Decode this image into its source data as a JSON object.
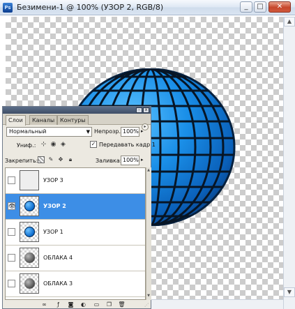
{
  "window": {
    "title": "Безимени-1 @ 100% (УЗОР 2, RGB/8)",
    "app_icon": "photoshop-icon",
    "controls": {
      "minimize": "_",
      "maximize": "□",
      "close": "✕"
    }
  },
  "canvas": {
    "background": "transparent-checkerboard",
    "object": "blue-grid-sphere",
    "sphere_color": "#1a8fe8",
    "grid_color": "#0a1a2a"
  },
  "layers_panel": {
    "tabs": [
      "Слои",
      "Каналы",
      "Контуры"
    ],
    "active_tab": "Слои",
    "blend_mode": "Нормальный",
    "opacity_label": "Непрозр.:",
    "opacity_value": "100%",
    "unify_label": "Униф.:",
    "propagate_label": "Передавать кадр 1",
    "propagate_checked": true,
    "lock_label": "Закрепить:",
    "fill_label": "Заливка:",
    "fill_value": "100%",
    "layers": [
      {
        "name": "УЗОР 3",
        "thumb": "blank",
        "visible": false,
        "selected": false
      },
      {
        "name": "УЗОР 2",
        "thumb": "blue-sphere",
        "visible": true,
        "selected": true
      },
      {
        "name": "УЗОР 1",
        "thumb": "blue-sphere",
        "visible": false,
        "selected": false
      },
      {
        "name": "ОБЛАКА 4",
        "thumb": "grey-sphere",
        "visible": false,
        "selected": false
      },
      {
        "name": "ОБЛАКА 3",
        "thumb": "grey-sphere",
        "visible": false,
        "selected": false
      }
    ],
    "selection_color": "#3d8ee6",
    "bottom_icons": [
      "link-icon",
      "layer-style-icon",
      "mask-icon",
      "adjustment-icon",
      "group-icon",
      "new-layer-icon",
      "trash-icon"
    ]
  }
}
